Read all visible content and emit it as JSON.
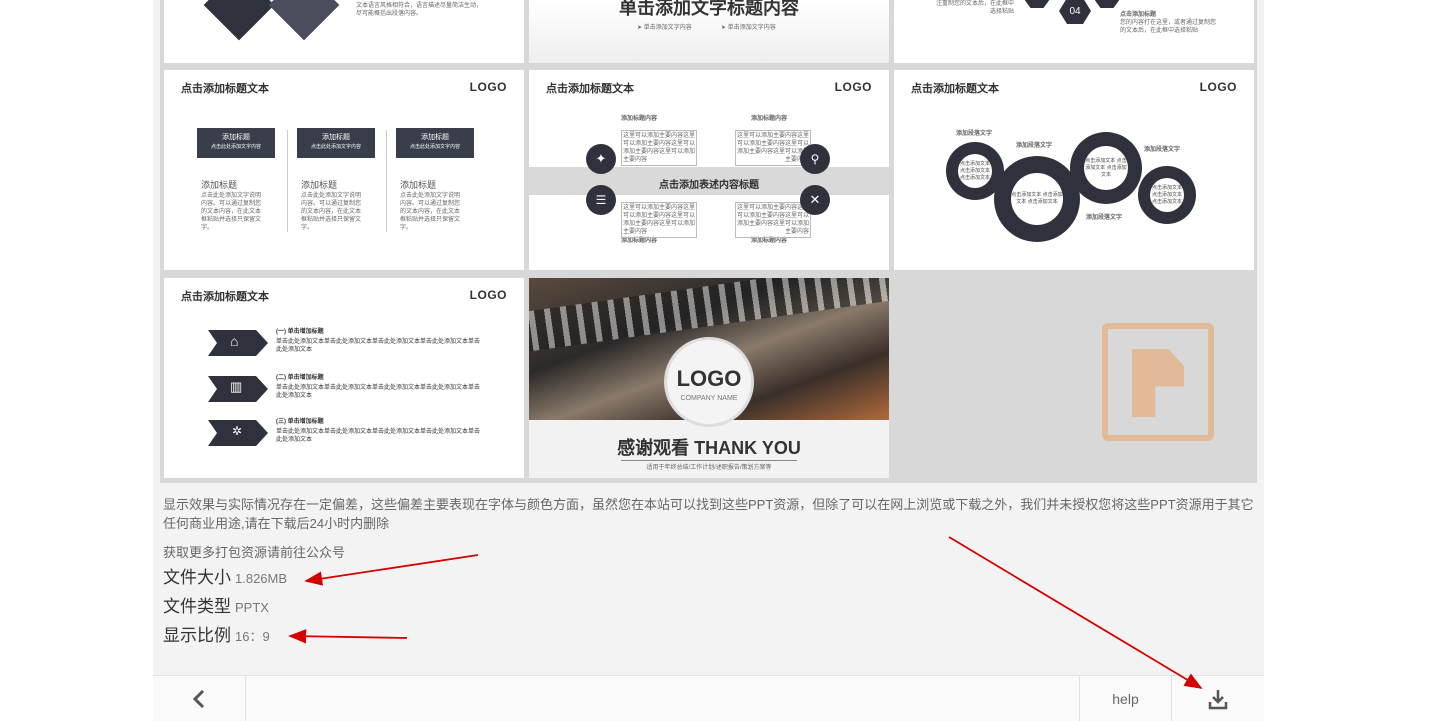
{
  "slides": {
    "top_center_heading": "单击添加文字标题内容",
    "top_center_sub1": "➤ 单击添加文字内容",
    "top_center_sub2": "➤ 单击添加文字内容",
    "top_left_text": "文本语言风格相符合，语言描述尽量简洁生动，尽可能概括出段落内容。",
    "top_right_num": "04",
    "top_right_text1": "注重制您的文本后，在此框中选择粘贴",
    "top_right_label": "点击添加标题",
    "top_right_text2": "您的内容打在这里，或者通过复制您的文本后，在此框中选择粘贴",
    "slide_title": "点击添加标题文本",
    "logo": "LOGO",
    "s1_box_title": "添加标题",
    "s1_box_sub": "点击此处添加文字内容",
    "s1_item_title": "添加标题",
    "s1_item_text": "点击此处添加文字说明内容。可以通过复制您的文本内容，在此文本框粘贴并选择只保留文字。",
    "s2_item_title": "添加标题内容",
    "s2_item_text": "这里可以添加主要内容这里可以添加主要内容这里可以添加主要内容这里可以添加主要内容",
    "s2_band": "点击添加表述内容标题",
    "s3_label": "添加段落文字",
    "s3_gear_text": "点击添加文本 点击添加文本 点击添加文本",
    "s4_items": [
      "(一) 单击增加标题",
      "(二) 单击增加标题",
      "(三) 单击增加标题"
    ],
    "s4_text": "单击此处添加文本单击此处添加文本单击此处添加文本单击此处添加文本单击此处添加文本",
    "s5_logo": "LOGO",
    "s5_company": "COMPANY NAME",
    "s5_thanks": "感谢观看 THANK YOU",
    "s5_sub": "适用于年终总结/工作计划/述职报告/策划方案等"
  },
  "info": {
    "disclaimer": "显示效果与实际情况存在一定偏差，这些偏差主要表现在字体与颜色方面，虽然您在本站可以找到这些PPT资源，但除了可以在网上浏览或下载之外，我们并未授权您将这些PPT资源用于其它任何商业用途,请在下载后24小时内删除",
    "more": "获取更多打包资源请前往公众号",
    "size_label": "文件大小",
    "size_value": "1.826MB",
    "type_label": "文件类型",
    "type_value": "PPTX",
    "ratio_label": "显示比例",
    "ratio_value": "16：9"
  },
  "bottombar": {
    "back_icon": "chevron-left-icon",
    "help": "help",
    "download_icon": "download-icon"
  },
  "colors": {
    "annotation_arrow": "#d40000",
    "placeholder_logo": "#e6b58c",
    "dark": "#2f323d"
  }
}
